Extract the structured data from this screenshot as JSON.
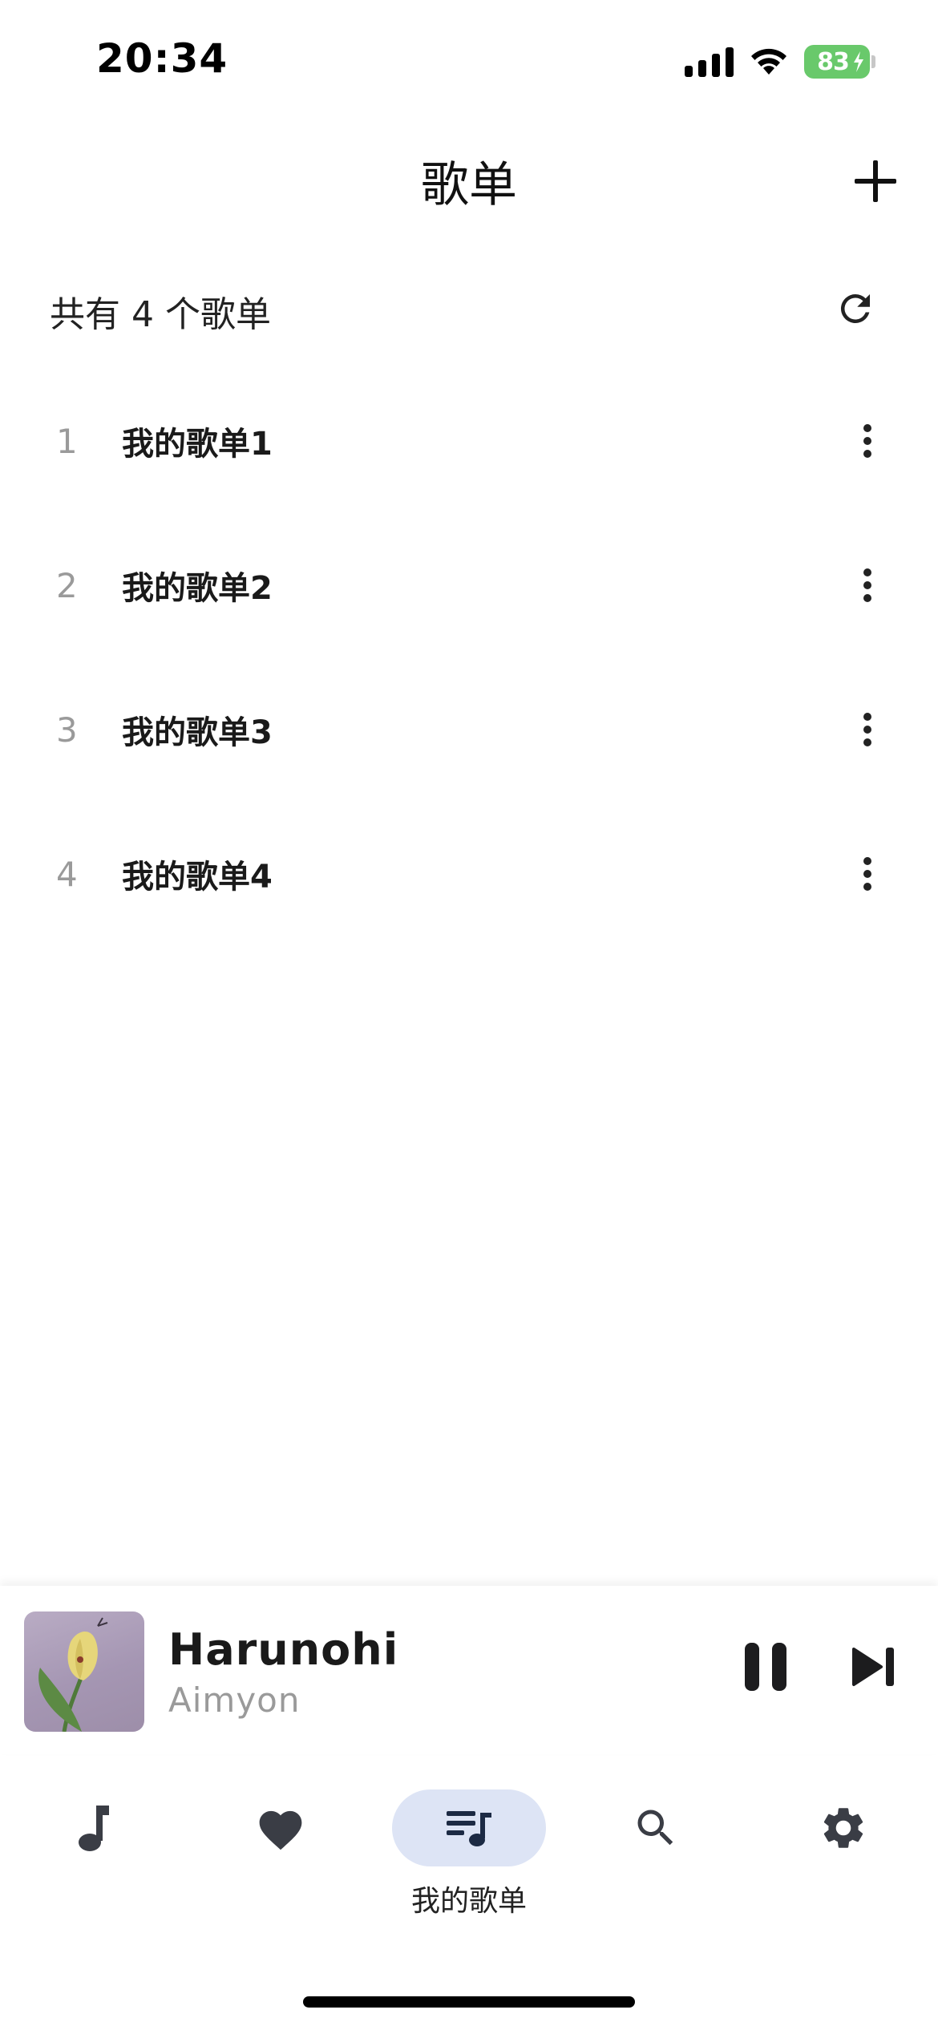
{
  "status_bar": {
    "time": "20:34",
    "battery_level": "83",
    "battery_color": "#69c96b"
  },
  "header": {
    "title": "歌单",
    "add_icon": "plus-icon"
  },
  "summary": {
    "text": "共有 4 个歌单",
    "refresh_icon": "refresh-icon"
  },
  "playlists": [
    {
      "index": "1",
      "name": "我的歌单1"
    },
    {
      "index": "2",
      "name": "我的歌单2"
    },
    {
      "index": "3",
      "name": "我的歌单3"
    },
    {
      "index": "4",
      "name": "我的歌单4"
    }
  ],
  "mini_player": {
    "title": "Harunohi",
    "artist": "Aimyon",
    "pause_icon": "pause-icon",
    "next_icon": "skip-next-icon"
  },
  "bottom_nav": {
    "items": [
      {
        "icon": "music-note-icon",
        "label": ""
      },
      {
        "icon": "heart-icon",
        "label": ""
      },
      {
        "icon": "playlist-icon",
        "label": "我的歌单",
        "active": true
      },
      {
        "icon": "search-icon",
        "label": ""
      },
      {
        "icon": "gear-icon",
        "label": ""
      }
    ],
    "active_color": "#dde4f5"
  }
}
